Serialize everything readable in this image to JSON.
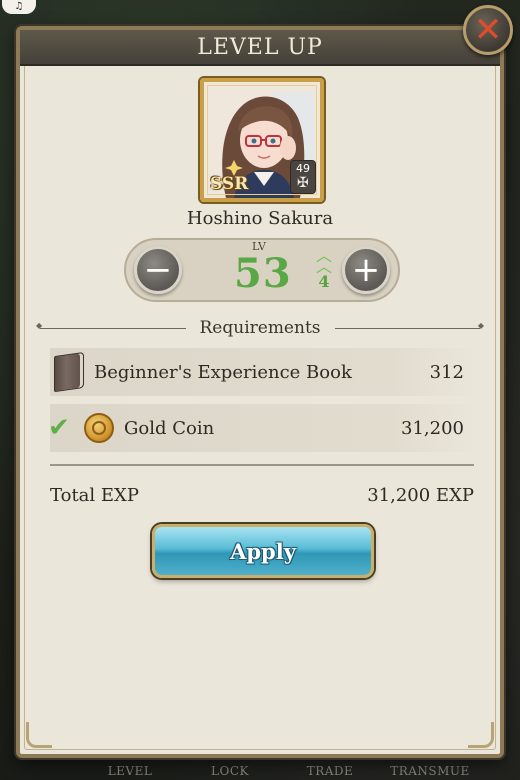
{
  "header": {
    "title": "LEVEL UP"
  },
  "character": {
    "name": "Hoshino Sakura",
    "rarity": "SSR",
    "cost": "49"
  },
  "level": {
    "label": "LV",
    "value": "53",
    "gain": "4"
  },
  "requirements": {
    "title": "Requirements",
    "items": [
      {
        "name": "Beginner's Experience Book",
        "amount": "312",
        "icon": "book-icon",
        "met": false
      },
      {
        "name": "Gold Coin",
        "amount": "31,200",
        "icon": "gold-coin-icon",
        "met": true
      }
    ]
  },
  "total": {
    "label": "Total EXP",
    "value": "31,200 EXP"
  },
  "apply_label": "Apply",
  "bottom_tabs": [
    "LEVEL",
    "LOCK",
    "TRADE",
    "TRANSMUE"
  ],
  "colors": {
    "level_green": "#5aa845",
    "apply_blue": "#58bcd6",
    "close_red": "#e24a2d",
    "frame_gold": "#c9a048"
  }
}
